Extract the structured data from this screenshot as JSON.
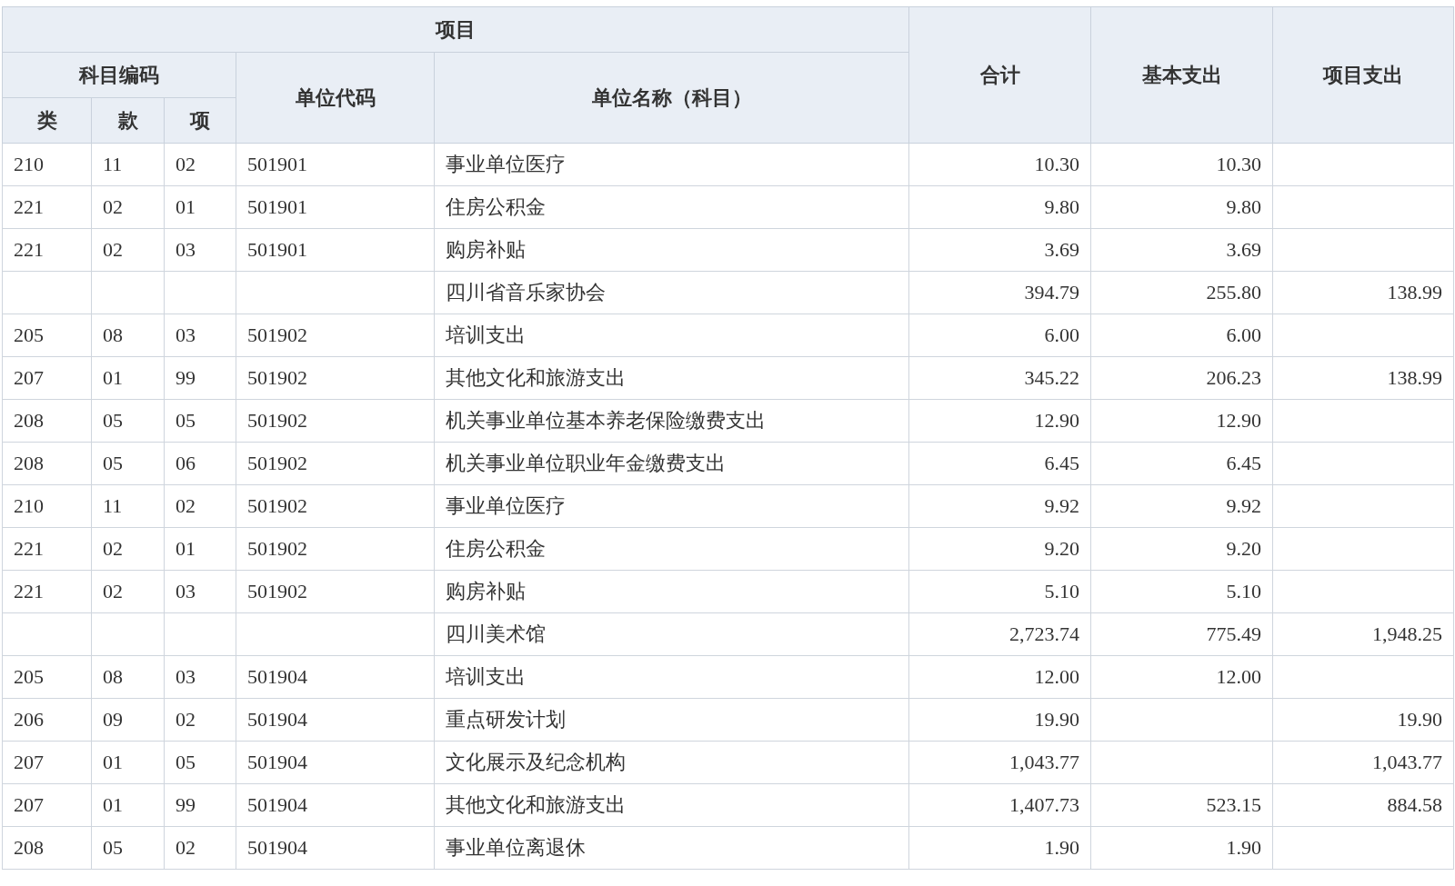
{
  "table": {
    "header": {
      "top": "项目",
      "code_group": "科目编码",
      "code_parts": [
        "类",
        "款",
        "项"
      ],
      "unit_code": "单位代码",
      "unit_name": "单位名称（科目）",
      "total": "合计",
      "basic": "基本支出",
      "project": "项目支出"
    },
    "rows": [
      {
        "lei": "210",
        "kuan": "11",
        "xiang": "02",
        "unit_code": "501901",
        "unit_name": "事业单位医疗",
        "total": "10.30",
        "basic": "10.30"
      },
      {
        "lei": "221",
        "kuan": "02",
        "xiang": "01",
        "unit_code": "501901",
        "unit_name": "住房公积金",
        "total": "9.80",
        "basic": "9.80"
      },
      {
        "lei": "221",
        "kuan": "02",
        "xiang": "03",
        "unit_code": "501901",
        "unit_name": "购房补贴",
        "total": "3.69",
        "basic": "3.69"
      },
      {
        "unit_name": "四川省音乐家协会",
        "total": "394.79",
        "basic": "255.80",
        "project": "138.99"
      },
      {
        "lei": "205",
        "kuan": "08",
        "xiang": "03",
        "unit_code": "501902",
        "unit_name": "培训支出",
        "total": "6.00",
        "basic": "6.00"
      },
      {
        "lei": "207",
        "kuan": "01",
        "xiang": "99",
        "unit_code": "501902",
        "unit_name": "其他文化和旅游支出",
        "total": "345.22",
        "basic": "206.23",
        "project": "138.99"
      },
      {
        "lei": "208",
        "kuan": "05",
        "xiang": "05",
        "unit_code": "501902",
        "unit_name": "机关事业单位基本养老保险缴费支出",
        "total": "12.90",
        "basic": "12.90"
      },
      {
        "lei": "208",
        "kuan": "05",
        "xiang": "06",
        "unit_code": "501902",
        "unit_name": "机关事业单位职业年金缴费支出",
        "total": "6.45",
        "basic": "6.45"
      },
      {
        "lei": "210",
        "kuan": "11",
        "xiang": "02",
        "unit_code": "501902",
        "unit_name": "事业单位医疗",
        "total": "9.92",
        "basic": "9.92"
      },
      {
        "lei": "221",
        "kuan": "02",
        "xiang": "01",
        "unit_code": "501902",
        "unit_name": "住房公积金",
        "total": "9.20",
        "basic": "9.20"
      },
      {
        "lei": "221",
        "kuan": "02",
        "xiang": "03",
        "unit_code": "501902",
        "unit_name": "购房补贴",
        "total": "5.10",
        "basic": "5.10"
      },
      {
        "unit_name": "四川美术馆",
        "total": "2,723.74",
        "basic": "775.49",
        "project": "1,948.25"
      },
      {
        "lei": "205",
        "kuan": "08",
        "xiang": "03",
        "unit_code": "501904",
        "unit_name": "培训支出",
        "total": "12.00",
        "basic": "12.00"
      },
      {
        "lei": "206",
        "kuan": "09",
        "xiang": "02",
        "unit_code": "501904",
        "unit_name": "重点研发计划",
        "total": "19.90",
        "project": "19.90"
      },
      {
        "lei": "207",
        "kuan": "01",
        "xiang": "05",
        "unit_code": "501904",
        "unit_name": "文化展示及纪念机构",
        "total": "1,043.77",
        "project": "1,043.77"
      },
      {
        "lei": "207",
        "kuan": "01",
        "xiang": "99",
        "unit_code": "501904",
        "unit_name": "其他文化和旅游支出",
        "total": "1,407.73",
        "basic": "523.15",
        "project": "884.58"
      },
      {
        "lei": "208",
        "kuan": "05",
        "xiang": "02",
        "unit_code": "501904",
        "unit_name": "事业单位离退休",
        "total": "1.90",
        "basic": "1.90"
      }
    ]
  }
}
